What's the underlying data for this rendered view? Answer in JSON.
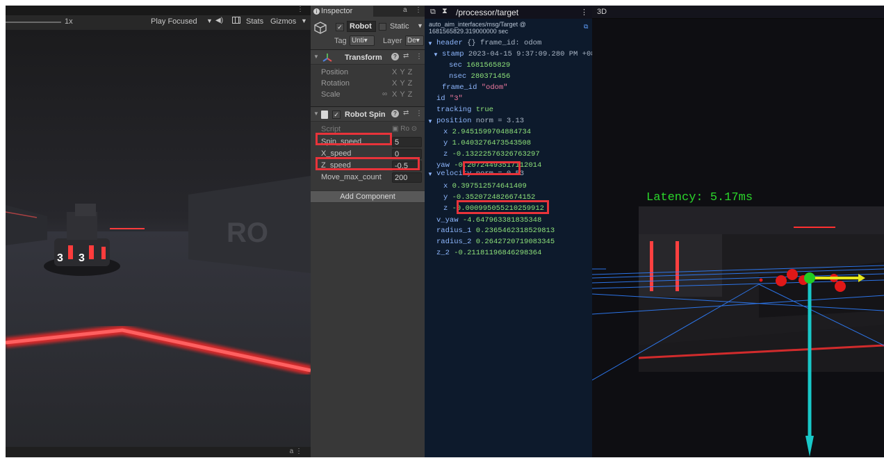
{
  "game_view": {
    "scale_label": "1x",
    "play_focused_label": "Play Focused",
    "stats_label": "Stats",
    "gizmos_label": "Gizmos",
    "scene_signs": [
      "RO",
      "3",
      "3"
    ]
  },
  "inspector": {
    "tab_label": "Inspector",
    "object": {
      "name": "Robot",
      "static_label": "Static",
      "tag_label": "Tag",
      "tag_value": "Unti▾",
      "layer_label": "Layer",
      "layer_value": "De▾"
    },
    "transform": {
      "title": "Transform",
      "rows": [
        {
          "label": "Position",
          "axes": "XYZ"
        },
        {
          "label": "Rotation",
          "axes": "XYZ"
        },
        {
          "label": "Scale",
          "axes": "XYZ"
        }
      ]
    },
    "robot_spin": {
      "title": "Robot Spin",
      "script_label": "Script",
      "script_value": "Ro",
      "fields": [
        {
          "label": "Spin_speed",
          "value": "5"
        },
        {
          "label": "X_speed",
          "value": "0"
        },
        {
          "label": "Z_speed",
          "value": "-0.5"
        },
        {
          "label": "Move_max_count",
          "value": "200"
        }
      ]
    },
    "add_component_label": "Add Component"
  },
  "topic": {
    "path": "/processor/target",
    "meta_line1": "auto_aim_interfaces/msg/Target @",
    "meta_line2": "1681565829.319000000 sec",
    "header_key": "header",
    "header_summary": "{} frame_id: odom",
    "stamp_key": "stamp",
    "stamp_value": "2023-04-15 9:37:09.280 PM +08",
    "sec_key": "sec",
    "sec_value": "1681565829",
    "nsec_key": "nsec",
    "nsec_value": "280371456",
    "frame_id_key": "frame_id",
    "frame_id_value": "\"odom\"",
    "id_key": "id",
    "id_value": "\"3\"",
    "tracking_key": "tracking",
    "tracking_value": "true",
    "position_key": "position",
    "position_norm": "norm = 3.13",
    "pos_x_key": "x",
    "pos_x": "2.9451599704884734",
    "pos_y_key": "y",
    "pos_y": "1.0403276473543508",
    "pos_z_key": "z",
    "pos_z": "-0.13222576326763297",
    "yaw_key": "yaw",
    "yaw_value": "-0.20724493517112014",
    "velocity_key": "velocity",
    "velocity_norm": "norm = 0.53",
    "vel_x_key": "x",
    "vel_x": "0.397512574641409",
    "vel_y_key": "y",
    "vel_y": "-0.3520724826674152",
    "vel_z_key": "z",
    "vel_z": "-0.000995055210259912",
    "v_yaw_key": "v_yaw",
    "v_yaw_value": "-4.647963381835348",
    "radius1_key": "radius_1",
    "radius1_value": "0.2365462318529813",
    "radius2_key": "radius_2",
    "radius2_value": "0.2642720719083345",
    "z2_key": "z_2",
    "z2_value": "-0.21181196846298364"
  },
  "three_d": {
    "title": "3D",
    "latency_label": "Latency: 5.17ms"
  },
  "colors": {
    "highlight": "#e8333a",
    "key": "#8fb8ff",
    "number": "#8ee27a",
    "string": "#f07aa0",
    "latency": "#2bd62b"
  }
}
